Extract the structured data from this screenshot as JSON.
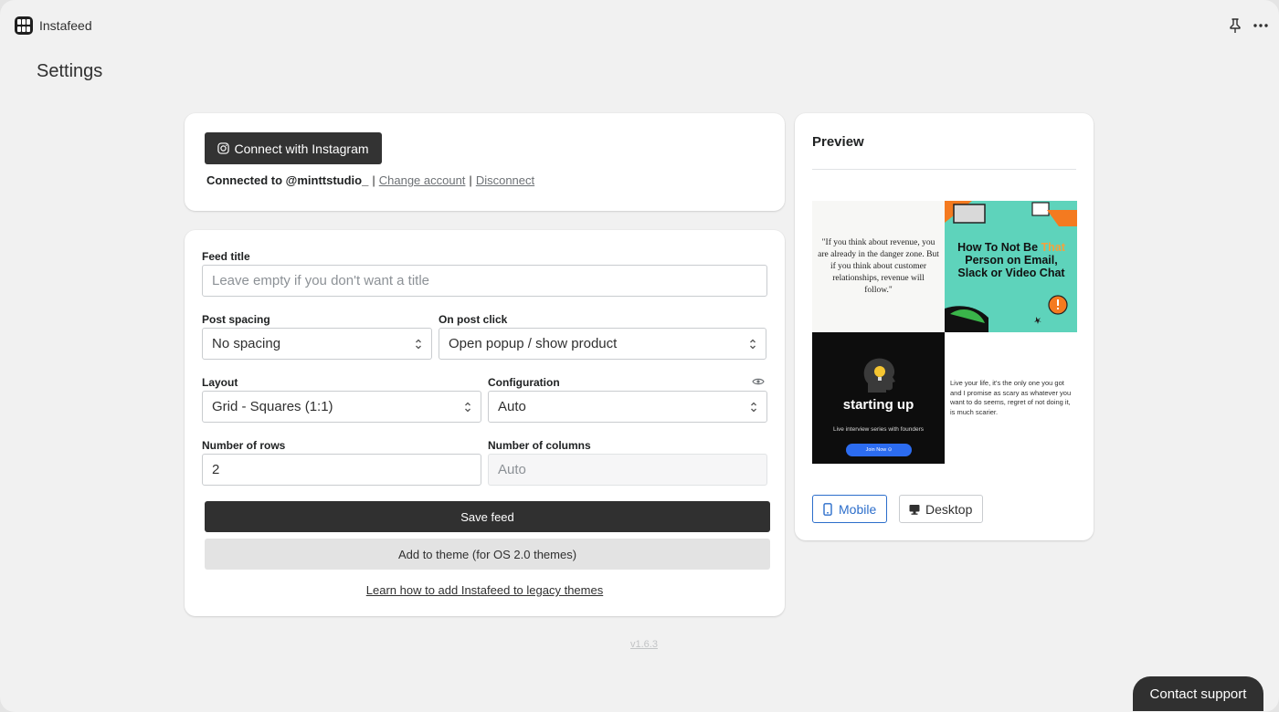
{
  "app": {
    "name": "Instafeed",
    "icon": "app-grid-icon",
    "header_icons": [
      "pin-icon",
      "more-icon"
    ]
  },
  "page": {
    "title": "Settings",
    "version": "v1.6.3"
  },
  "connect": {
    "button_label": "Connect with Instagram",
    "button_icon": "instagram-icon",
    "connected_prefix": "Connected to @minttstudio_",
    "change_account": "Change account",
    "disconnect": "Disconnect"
  },
  "form": {
    "feed_title": {
      "label": "Feed title",
      "value": "",
      "placeholder": "Leave empty if you don't want a title"
    },
    "post_spacing": {
      "label": "Post spacing",
      "value": "No spacing"
    },
    "on_post_click": {
      "label": "On post click",
      "value": "Open popup / show product"
    },
    "layout": {
      "label": "Layout",
      "value": "Grid - Squares (1:1)"
    },
    "configuration": {
      "label": "Configuration",
      "value": "Auto",
      "icon": "eye-icon"
    },
    "rows": {
      "label": "Number of rows",
      "value": "2"
    },
    "columns": {
      "label": "Number of columns",
      "value": "Auto"
    },
    "save_label": "Save feed",
    "add_theme_label": "Add to theme (for OS 2.0 themes)",
    "learn_link": "Learn how to add Instafeed to legacy themes"
  },
  "preview": {
    "title": "Preview",
    "posts": [
      {
        "text": "\"If you think about revenue, you are already in the danger zone. But if you think about customer relationships, revenue will follow.\""
      },
      {
        "text_before": "How To Not Be ",
        "highlight": "That",
        "text_after": " Person on Email, Slack or Video Chat"
      },
      {
        "title": "starting up",
        "subtitle": "Live interview series with founders",
        "button": "Join Now ⊙"
      },
      {
        "text": "Live your life, it's the only one you got and I promise as scary as whatever you want to do seems, regret of not doing it, is much scarier."
      }
    ],
    "tabs": [
      {
        "label": "Mobile",
        "icon": "mobile-icon",
        "active": true
      },
      {
        "label": "Desktop",
        "icon": "desktop-icon",
        "active": false
      }
    ]
  },
  "support": {
    "label": "Contact support"
  },
  "colors": {
    "background": "#f1f1f1",
    "primary_button": "#303030",
    "active_tab": "#2c6ecb"
  }
}
